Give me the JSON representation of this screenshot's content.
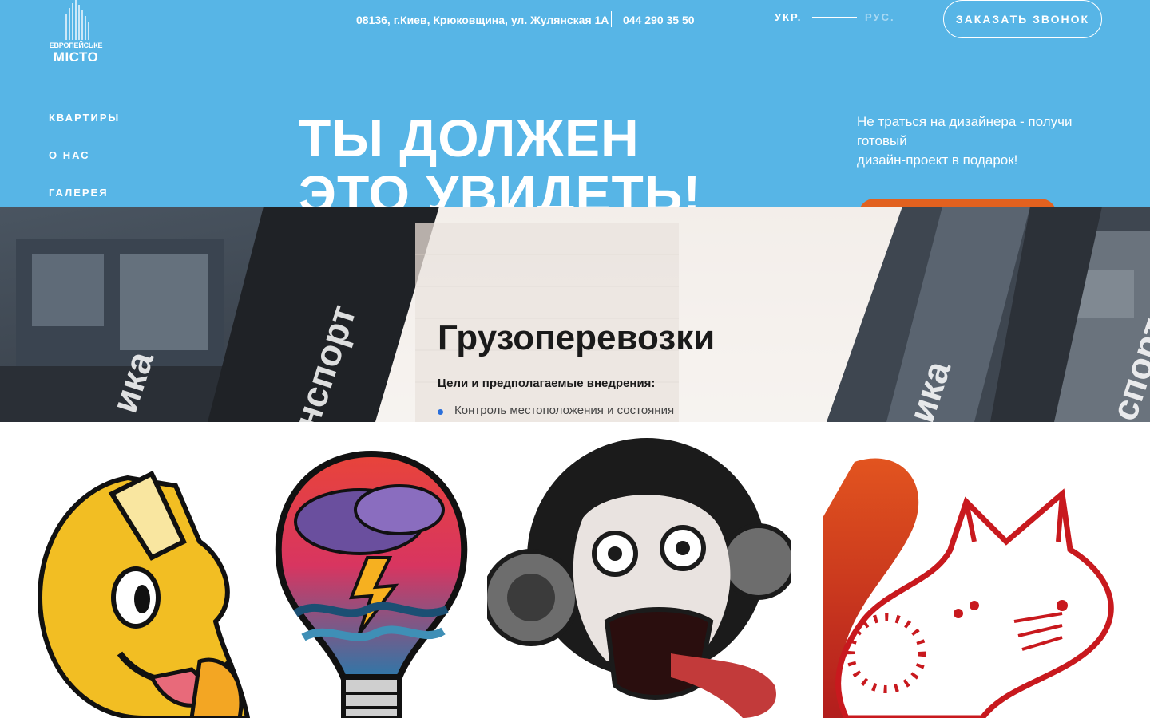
{
  "header": {
    "logo_top": "ЕВРОПЕЙСЬКЕ",
    "logo_bottom": "МІСТО",
    "address": "08136, г.Киев, Крюковщина, ул. Жулянская 1А",
    "phone": "044 290 35 50",
    "lang_ukr": "УКР.",
    "lang_rus": "РУС.",
    "callback_label": "ЗАКАЗАТЬ ЗВОНОК"
  },
  "nav": {
    "items": [
      "КВАРТИРЫ",
      "О НАС",
      "ГАЛЕРЕЯ"
    ]
  },
  "hero": {
    "headline_line1": "ТЫ ДОЛЖЕН",
    "headline_line2": "ЭТО УВИДЕТЬ!",
    "promo_line1": "Не траться на дизайнера - получи",
    "promo_line2": "готовый",
    "promo_line3": "дизайн-проект в подарок!"
  },
  "banner": {
    "title": "Грузоперевозки",
    "subtitle": "Цели и предполагаемые внедрения:",
    "item": "Контроль местоположения и состояния",
    "side_words": [
      "ика",
      "нспорт",
      "ика",
      "спорт"
    ]
  },
  "colors": {
    "hero_bg": "#57b5e6",
    "accent_orange": "#e2611f",
    "bullet_blue": "#2a6fdb"
  },
  "stickers": [
    "yellow-character-sticker",
    "lightbulb-storm-sticker",
    "monkey-sticker",
    "red-fox-cat-sticker"
  ]
}
